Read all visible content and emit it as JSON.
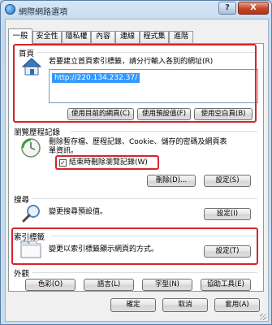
{
  "window": {
    "title": "網際網路選項",
    "help_label": "?",
    "close_label": "X"
  },
  "tabs": [
    "一般",
    "安全性",
    "隱私權",
    "內容",
    "連線",
    "程式集",
    "進階"
  ],
  "home": {
    "heading": "首頁",
    "description": "若要建立首頁索引標籤，請分行輸入各別的網址(R)",
    "url_value": "http://220.134.232.37/",
    "icon": "house-icon",
    "buttons": [
      "使用目前的網頁(C)",
      "使用預設值(F)",
      "使用空白頁(B)"
    ]
  },
  "history": {
    "heading": "瀏覽歷程記錄",
    "description_line1": "刪除暫存檔、歷程記錄、Cookie、儲存的密碼及網頁表",
    "description_line2": "單資訊。",
    "icon": "history-clock-icon",
    "checkbox_label": "結束時刪除瀏覽記錄(W)",
    "checkbox_checked": true,
    "delete_button": "刪除(D)...",
    "settings_button": "設定(S)"
  },
  "search": {
    "heading": "搜尋",
    "description": "變更搜尋預設值。",
    "icon": "magnifier-icon",
    "settings_button": "設定(I)"
  },
  "tabs_section": {
    "heading": "索引標籤",
    "description": "變更以索引標籤顯示網頁的方式。",
    "icon": "tabbed-window-icon",
    "settings_button": "設定(T)"
  },
  "appearance": {
    "heading": "外觀",
    "buttons": [
      "色彩(O)",
      "語言(L)",
      "字型(N)",
      "協助工具(E)"
    ]
  },
  "footer": {
    "ok": "確定",
    "cancel": "取消",
    "apply": "套用(A)"
  },
  "colors": {
    "highlight_box": "#d4262b",
    "selection": "#3399ff"
  }
}
